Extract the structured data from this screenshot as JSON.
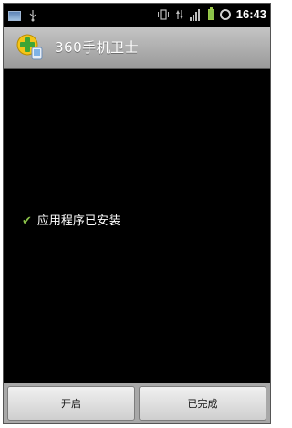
{
  "status_bar": {
    "icons_left": [
      "image-icon",
      "usb-icon"
    ],
    "icons_right": [
      "vibrate-icon",
      "data-transfer-icon",
      "signal-icon",
      "battery-icon",
      "alarm-icon"
    ],
    "time": "16:43"
  },
  "title_bar": {
    "app_icon": "360-plus-icon",
    "title": "360手机卫士"
  },
  "content": {
    "status_icon": "check-icon",
    "status_text": "应用程序已安装"
  },
  "buttons": {
    "open_label": "开启",
    "done_label": "已完成"
  },
  "colors": {
    "background": "#000000",
    "titlebar": "#b0b0b0",
    "check": "#8bc34a",
    "button": "#dcdcdc"
  }
}
